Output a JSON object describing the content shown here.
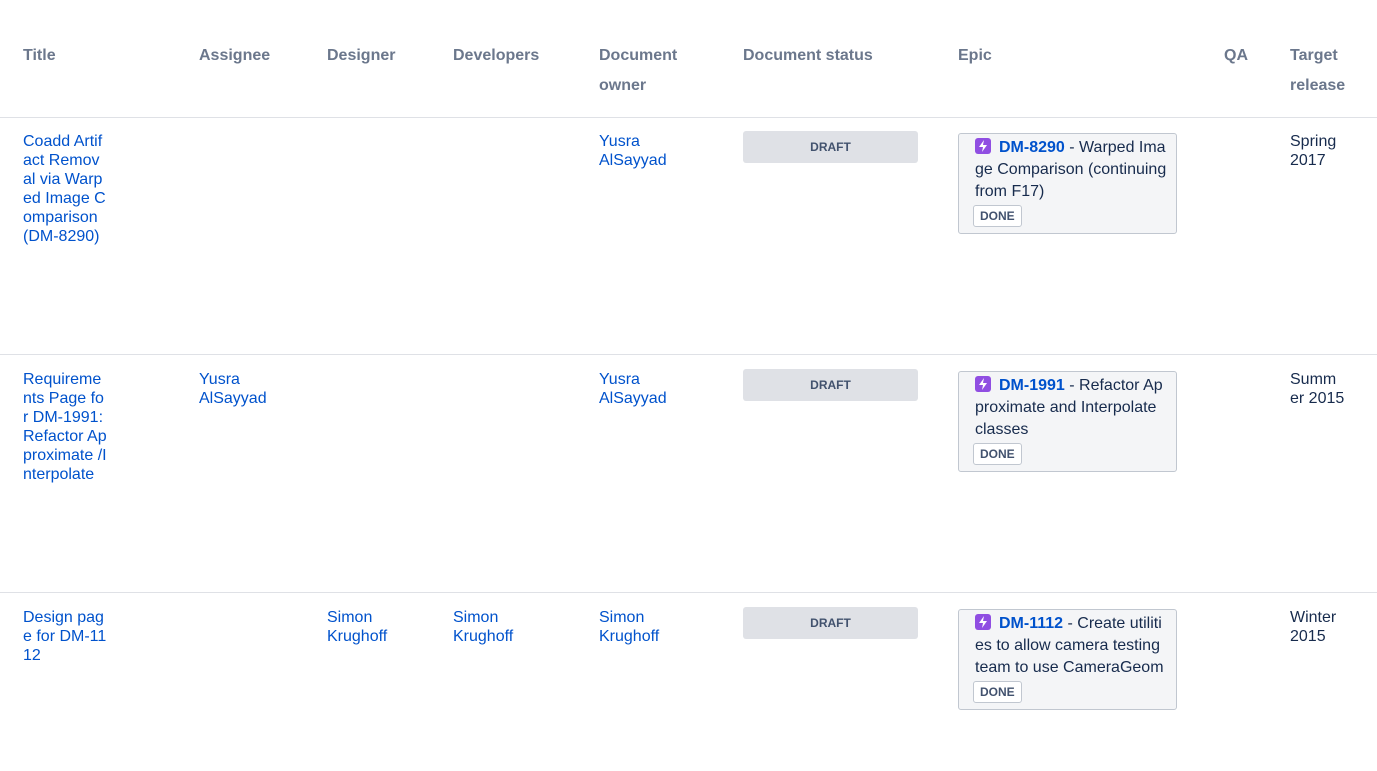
{
  "columns": {
    "title": "Title",
    "assignee": "Assignee",
    "designer": "Designer",
    "developers": "Developers",
    "document_owner_line1": "Document",
    "document_owner_line2": "owner",
    "document_status": "Document status",
    "epic": "Epic",
    "qa": "QA",
    "target_release_line1": "Target",
    "target_release_line2": "release"
  },
  "rows": [
    {
      "title": "Coadd Artifact Removal via Warped Image Comparison (DM-8290)",
      "assignee": "",
      "designer": "",
      "developers": "",
      "owner": "Yusra AlSayyad",
      "status": "DRAFT",
      "epic_key": "DM-8290",
      "epic_summary": " - Warped Image Comparison (continuing from F17)",
      "epic_status": "DONE",
      "qa": "",
      "release": "Spring 2017"
    },
    {
      "title": "Requirements Page for DM-1991: Refactor Approximate /Interpolate",
      "assignee": "Yusra AlSayyad",
      "designer": "",
      "developers": "",
      "owner": "Yusra AlSayyad",
      "status": "DRAFT",
      "epic_key": "DM-1991",
      "epic_summary": " - Refactor Approximate and Interpolate classes",
      "epic_status": "DONE",
      "qa": "",
      "release": "Summer 2015"
    },
    {
      "title": "Design page for DM-1112",
      "assignee": "",
      "designer": "Simon Krughoff",
      "developers": "Simon Krughoff",
      "owner": "Simon Krughoff",
      "status": "DRAFT",
      "epic_key": "DM-1112",
      "epic_summary": " - Create utilities to allow camera testing team to use CameraGeom",
      "epic_status": "DONE",
      "qa": "",
      "release": "Winter 2015"
    }
  ],
  "colors": {
    "link": "#0052cc",
    "header_text": "#6b778c",
    "epic_icon": "#904ee2",
    "status_bg": "#dfe1e6"
  }
}
